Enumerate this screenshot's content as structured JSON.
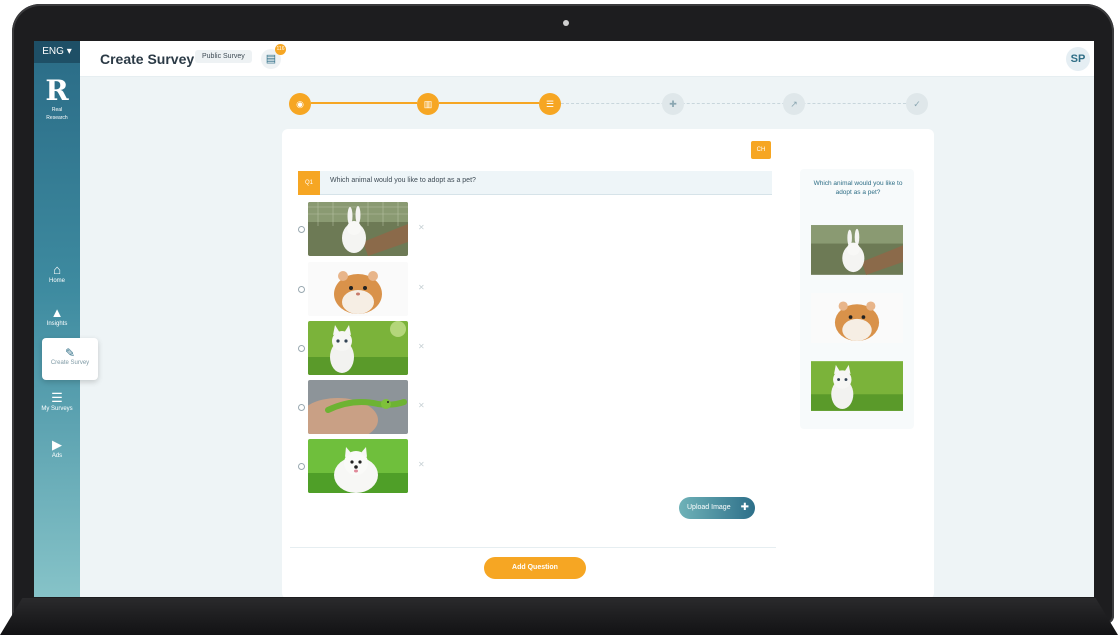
{
  "header": {
    "language": "ENG",
    "title": "Create Survey",
    "badge": "Public Survey",
    "doc_count": "116",
    "avatar": "SP"
  },
  "brand": {
    "logo_text": "Real Research"
  },
  "sidebar": {
    "items": [
      {
        "label": "Home",
        "icon": "home-icon"
      },
      {
        "label": "Insights",
        "icon": "chart-icon"
      },
      {
        "label": "Create Survey",
        "icon": "pencil-icon",
        "active": true
      },
      {
        "label": "My Surveys",
        "icon": "list-icon"
      },
      {
        "label": "Ads",
        "icon": "play-icon"
      }
    ]
  },
  "stepper": {
    "steps": [
      {
        "icon": "coins-icon",
        "state": "done"
      },
      {
        "icon": "bank-icon",
        "state": "done"
      },
      {
        "icon": "list-icon",
        "state": "current"
      },
      {
        "icon": "puzzle-icon",
        "state": "todo"
      },
      {
        "icon": "trend-icon",
        "state": "todo"
      },
      {
        "icon": "check-icon",
        "state": "todo"
      }
    ]
  },
  "editor": {
    "language_chip": "CH",
    "question_number": "Q1",
    "question_text": "Which animal would you like to adopt as a pet?",
    "options": [
      {
        "image": "white rabbit"
      },
      {
        "image": "hamster"
      },
      {
        "image": "white kitten"
      },
      {
        "image": "green lizard"
      },
      {
        "image": "white puppy"
      }
    ],
    "upload_label": "Upload Image",
    "add_question_label": "Add Question"
  },
  "preview": {
    "question_text": "Which animal would you like to adopt as a pet?"
  },
  "colors": {
    "accent": "#f6a623",
    "sidebar_top": "#2a6b86",
    "sidebar_bottom": "#86c3c8",
    "primary_text": "#2f6e86"
  }
}
